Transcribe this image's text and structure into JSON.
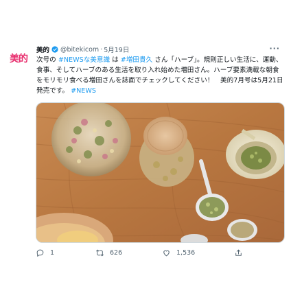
{
  "account": {
    "avatar_text": "美的",
    "name": "美的",
    "handle": "@bitekicom",
    "separator": "·",
    "date": "5月19日"
  },
  "tweet": {
    "segments": [
      {
        "text": "次号の ",
        "tag": false
      },
      {
        "text": "#NEWSな美意識",
        "tag": true
      },
      {
        "text": " は ",
        "tag": false
      },
      {
        "text": "#増田貴久",
        "tag": true
      },
      {
        "text": " さん「ハーブ」。規則正しい生活に、運動、食事、そしてハーブのある生活を取り入れ始めた増田さん。ハーブ要素満載な朝食をモリモリ食べる増田さんを誌面でチェックしてください！　美的7月号は5月21日発売です。 ",
        "tag": false
      },
      {
        "text": "#NEWS",
        "tag": true
      }
    ]
  },
  "actions": {
    "reply_count": "1",
    "retweet_count": "626",
    "like_count": "1,536"
  },
  "colors": {
    "brand": "#e8306f",
    "link": "#1d9bf0",
    "muted": "#536471"
  },
  "icons": [
    "verified-badge-icon",
    "more-icon",
    "reply-icon",
    "retweet-icon",
    "like-icon",
    "share-icon"
  ]
}
